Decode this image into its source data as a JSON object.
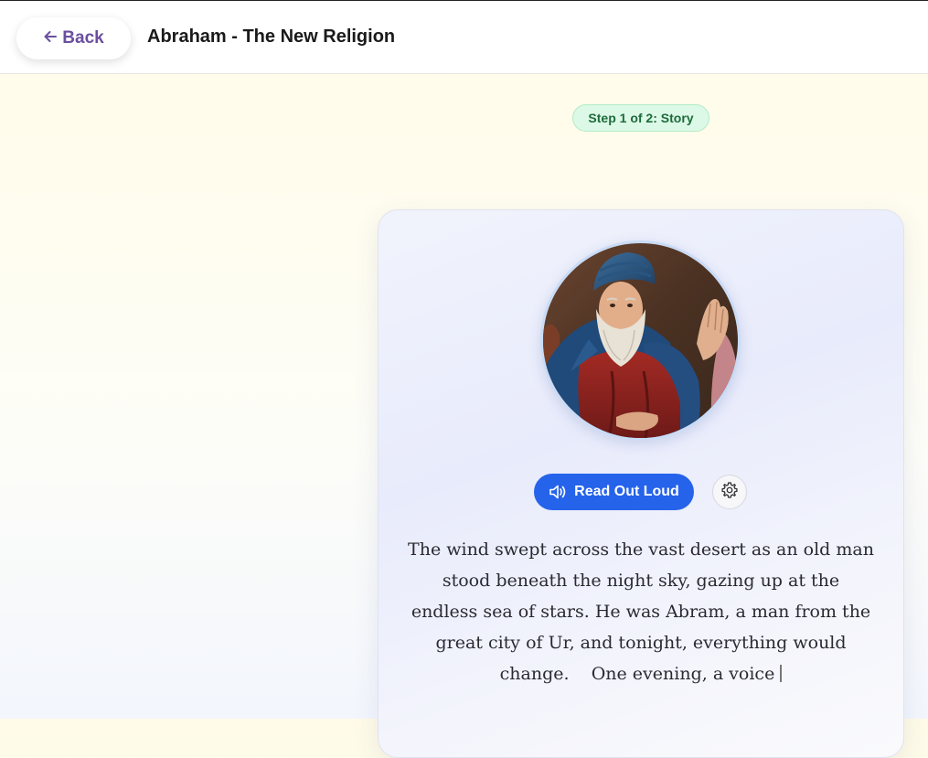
{
  "header": {
    "back_label": "Back",
    "title": "Abraham - The New Religion"
  },
  "step_badge": "Step 1 of 2: Story",
  "story": {
    "portrait_icon": "abraham-portrait",
    "read_aloud_label": "Read Out Loud",
    "settings_icon": "gear-icon",
    "text": "The wind swept across the vast desert as an old man stood beneath the night sky, gazing up at the endless sea of stars. He was Abram, a man from the great city of Ur, and tonight, everything would change.    One evening, a voice"
  },
  "colors": {
    "accent": "#2563eb",
    "back_text": "#6b4f9e",
    "badge_bg": "#dcf8e6",
    "badge_text": "#1e6b3c"
  }
}
